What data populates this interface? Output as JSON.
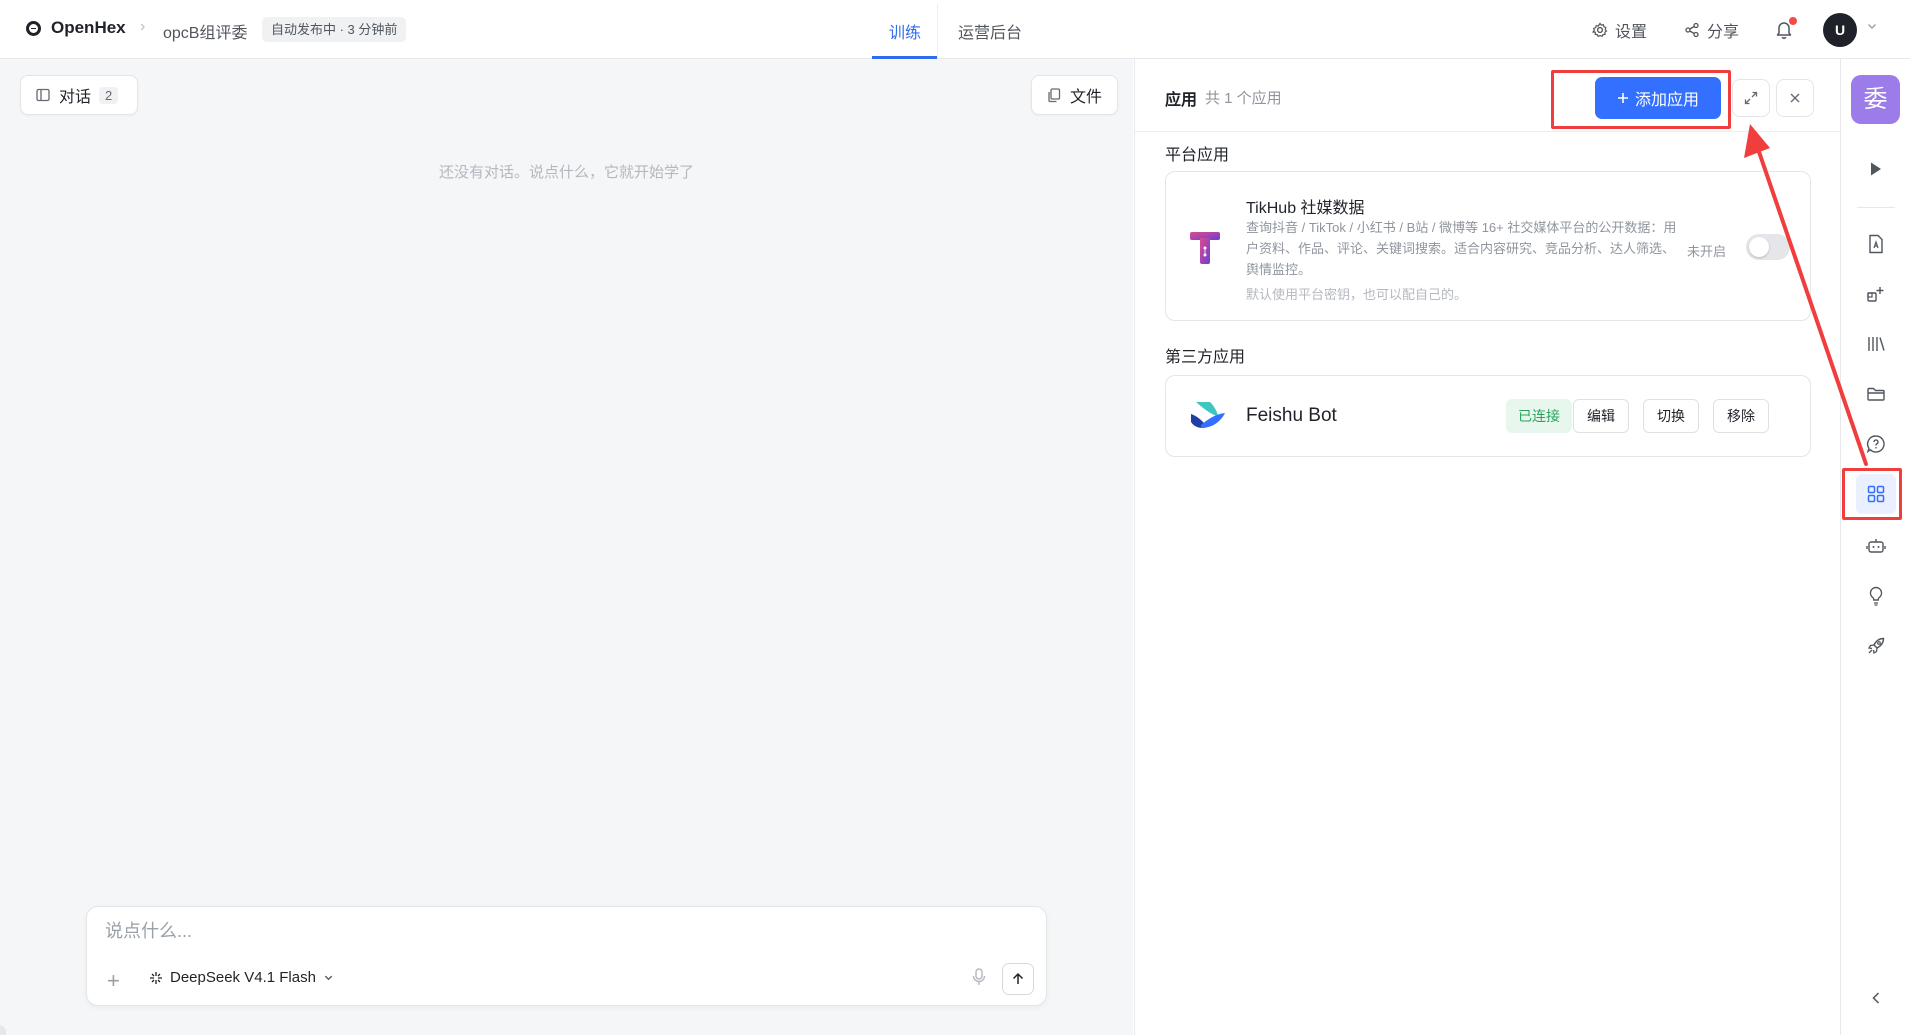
{
  "topbar": {
    "brand": "OpenHex",
    "separator": "›",
    "project": "opcB组评委",
    "publish_status": "自动发布中 · 3 分钟前",
    "tabs": [
      {
        "label": "训练",
        "active": true
      },
      {
        "label": "运营后台",
        "active": false
      }
    ],
    "settings_label": "设置",
    "share_label": "分享",
    "avatar_initial": "U"
  },
  "chat": {
    "conversations_label": "对话",
    "conversations_count": "2",
    "files_label": "文件",
    "empty_hint": "还没有对话。说点什么，它就开始学了",
    "input_placeholder": "说点什么...",
    "model_name": "DeepSeek V4.1 Flash"
  },
  "apps_panel": {
    "title": "应用",
    "count_label": "共 1 个应用",
    "add_button": "添加应用",
    "platform_section": "平台应用",
    "third_party_section": "第三方应用",
    "platform_apps": [
      {
        "name": "TikHub 社媒数据",
        "description": "查询抖音 / TikTok / 小红书 / B站 / 微博等 16+ 社交媒体平台的公开数据：用户资料、作品、评论、关键词搜索。适合内容研究、竞品分析、达人筛选、舆情监控。",
        "note": "默认使用平台密钥，也可以配自己的。",
        "status": "未开启",
        "enabled": false
      }
    ],
    "third_party_apps": [
      {
        "name": "Feishu Bot",
        "status": "已连接",
        "actions": [
          "编辑",
          "切换",
          "移除"
        ]
      }
    ]
  },
  "rail": {
    "avatar_char": "委",
    "icons": [
      "play-icon",
      "document-icon",
      "blocks-add-icon",
      "library-icon",
      "folder-icon",
      "chat-question-icon",
      "apps-grid-icon",
      "robot-icon",
      "lightbulb-icon",
      "rocket-icon",
      "collapse-left-icon"
    ],
    "active": "apps-grid-icon"
  },
  "annotation_colors": {
    "highlight": "#f03e3e",
    "accent": "#3370ff"
  }
}
